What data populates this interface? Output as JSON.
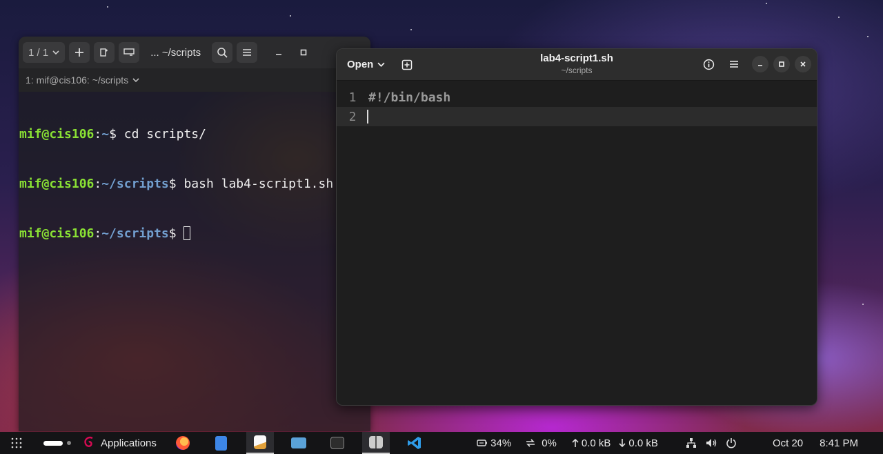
{
  "terminal": {
    "tab_counter": "1 / 1",
    "title": "... ~/scripts",
    "tab_label": "1: mif@cis106: ~/scripts",
    "lines": [
      {
        "user": "mif@cis106",
        "sep": ":",
        "path": "~",
        "prompt": "$ ",
        "cmd": "cd scripts/"
      },
      {
        "user": "mif@cis106",
        "sep": ":",
        "path": "~/scripts",
        "prompt": "$ ",
        "cmd": "bash lab4-script1.sh"
      },
      {
        "user": "mif@cis106",
        "sep": ":",
        "path": "~/scripts",
        "prompt": "$ ",
        "cmd": ""
      }
    ]
  },
  "editor": {
    "open_label": "Open",
    "filename": "lab4-script1.sh",
    "path": "~/scripts",
    "lines": [
      {
        "num": "1",
        "text": "#!/bin/bash"
      },
      {
        "num": "2",
        "text": ""
      }
    ]
  },
  "taskbar": {
    "applications_label": "Applications",
    "apps": [
      "firefox-icon",
      "files-icon",
      "text-editor-icon",
      "screenshot-icon",
      "terminal-icon",
      "tilix-icon",
      "vscode-icon"
    ],
    "battery": "34%",
    "cpu": "0%",
    "upload": "0.0 kB",
    "download": "0.0 kB",
    "date": "Oct 20",
    "time": "8:41 PM"
  }
}
